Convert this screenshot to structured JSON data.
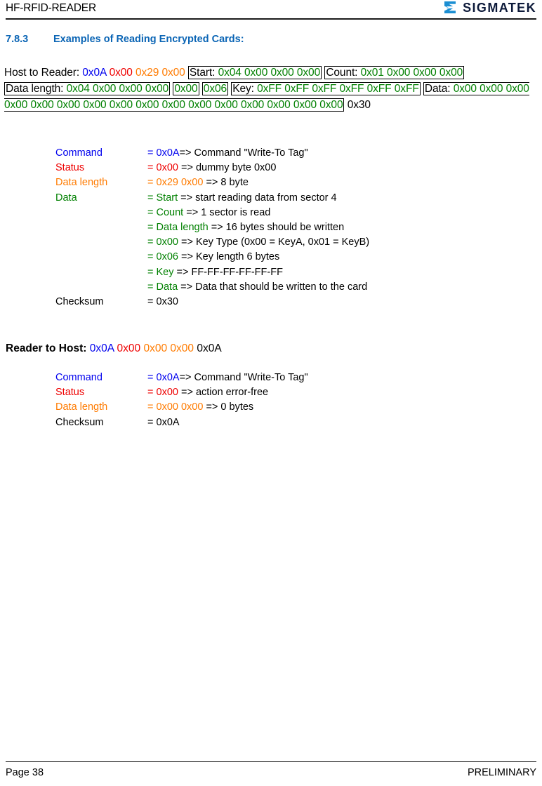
{
  "header": {
    "title": "HF-RFID-READER",
    "brand_name": "SIGMATEK",
    "brand_color": "#1b8ed2",
    "rule_color": "#1a1a1a"
  },
  "section": {
    "number": "7.8.3",
    "title": "Examples of Reading Encrypted Cards:",
    "color": "#0b65b5"
  },
  "colors": {
    "command": "#0000ee",
    "status": "#ee0000",
    "data_length": "#ff7b00",
    "data": "#008000",
    "plain": "#000000"
  },
  "host_to_reader": {
    "label": "Host to Reader:",
    "segments": [
      {
        "text": "Host to Reader:",
        "color": "plain",
        "boxed": false
      },
      {
        "text": "0x0A",
        "color": "command",
        "boxed": false
      },
      {
        "text": "0x00",
        "color": "status",
        "boxed": false
      },
      {
        "text": "0x29",
        "color": "data_length",
        "boxed": false
      },
      {
        "text": "0x00",
        "color": "data_length",
        "boxed": false
      },
      {
        "text": "Start: 0x04 0x00 0x00 0x00",
        "color": "mixed-start",
        "boxed": true
      },
      {
        "text": "Count: 0x01 0x00 0x00 0x00",
        "color": "mixed-count",
        "boxed": true
      },
      {
        "text": "Data length: 0x04 0x00 0x00 0x00",
        "color": "mixed-length",
        "boxed": true
      },
      {
        "text": "0x00",
        "color": "data",
        "boxed": true
      },
      {
        "text": "0x06",
        "color": "data",
        "boxed": true
      },
      {
        "text": "Key: 0xFF 0xFF 0xFF 0xFF 0xFF 0xFF",
        "color": "mixed-key",
        "boxed": true
      },
      {
        "text": "Data: 0x00 ×16",
        "color": "mixed-data",
        "boxed": true
      },
      {
        "text": "0x30",
        "color": "plain",
        "boxed": false
      }
    ],
    "prefix_bytes": {
      "command": "0x0A",
      "status": "0x00",
      "data_length": [
        "0x29",
        "0x00"
      ]
    },
    "start_box": {
      "label": "Start:",
      "bytes": [
        "0x04",
        "0x00",
        "0x00",
        "0x00"
      ]
    },
    "count_box": {
      "label": "Count:",
      "bytes": [
        "0x01",
        "0x00",
        "0x00",
        "0x00"
      ]
    },
    "length_box": {
      "label": "Data length:",
      "bytes": [
        "0x04",
        "0x00",
        "0x00",
        "0x00"
      ]
    },
    "keytype_box": {
      "bytes": [
        "0x00"
      ]
    },
    "keylen_box": {
      "bytes": [
        "0x06"
      ]
    },
    "key_box": {
      "label": "Key:",
      "bytes": [
        "0xFF",
        "0xFF",
        "0xFF",
        "0xFF",
        "0xFF",
        "0xFF"
      ]
    },
    "data_box": {
      "label": "Data:",
      "bytes": [
        "0x00",
        "0x00",
        "0x00",
        "0x00",
        "0x00",
        "0x00",
        "0x00",
        "0x00",
        "0x00",
        "0x00",
        "0x00",
        "0x00",
        "0x00",
        "0x00",
        "0x00",
        "0x00"
      ]
    },
    "checksum": "0x30"
  },
  "host_description": {
    "rows": [
      {
        "label": "Command",
        "label_color": "command",
        "eq": "= ",
        "value": "0x0A",
        "value_color": "command",
        "rest": "=> Command \"Write-To Tag\""
      },
      {
        "label": "Status",
        "label_color": "status",
        "eq": "= ",
        "value": "0x00",
        "value_color": "status",
        "rest": " => dummy byte 0x00"
      },
      {
        "label": "Data length",
        "label_color": "data_length",
        "eq": "=  ",
        "value": "0x29 0x00",
        "value_color": "data_length",
        "rest": " => 8 byte"
      },
      {
        "label": "Data",
        "label_color": "data",
        "eq": "= ",
        "value": "Start",
        "value_color": "data",
        "rest": " => start reading data from sector 4"
      },
      {
        "label": "",
        "label_color": "plain",
        "eq": "= ",
        "value": "Count",
        "value_color": "data",
        "rest": " => 1 sector is read"
      },
      {
        "label": "",
        "label_color": "plain",
        "eq": "= ",
        "value": "Data length",
        "value_color": "data",
        "rest": " => 16 bytes should be written"
      },
      {
        "label": "",
        "label_color": "plain",
        "eq": "= ",
        "value": "0x00",
        "value_color": "data",
        "rest": " => Key Type (0x00 = KeyA, 0x01 = KeyB)"
      },
      {
        "label": "",
        "label_color": "plain",
        "eq": "= ",
        "value": "0x06",
        "value_color": "data",
        "rest": " => Key length 6 bytes"
      },
      {
        "label": "",
        "label_color": "plain",
        "eq": "= ",
        "value": "Key",
        "value_color": "data",
        "rest": " => FF-FF-FF-FF-FF-FF"
      },
      {
        "label": "",
        "label_color": "plain",
        "eq": "= ",
        "value": "Data",
        "value_color": "data",
        "rest": " => Data that should be written to the card"
      },
      {
        "label": "Checksum",
        "label_color": "plain",
        "eq": "= ",
        "value": "0x30",
        "value_color": "plain",
        "rest": ""
      }
    ]
  },
  "reader_to_host": {
    "label": "Reader to Host:",
    "bytes": [
      {
        "text": "0x0A",
        "color": "command"
      },
      {
        "text": "0x00",
        "color": "status"
      },
      {
        "text": "0x00",
        "color": "data_length"
      },
      {
        "text": "0x00",
        "color": "data_length"
      },
      {
        "text": "0x0A",
        "color": "plain"
      }
    ]
  },
  "reader_description": {
    "rows": [
      {
        "label": "Command",
        "label_color": "command",
        "eq": "= ",
        "value": "0x0A",
        "value_color": "command",
        "rest": "=> Command \"Write-To Tag\""
      },
      {
        "label": "Status",
        "label_color": "status",
        "eq": "= ",
        "value": "0x00",
        "value_color": "status",
        "rest": " => action error-free"
      },
      {
        "label": "Data length",
        "label_color": "data_length",
        "eq": "=  ",
        "value": "0x00 0x00",
        "value_color": "data_length",
        "rest": " => 0 bytes"
      },
      {
        "label": "Checksum",
        "label_color": "plain",
        "eq": "= ",
        "value": "0x0A",
        "value_color": "plain",
        "rest": ""
      }
    ]
  },
  "footer": {
    "page": "Page 38",
    "status": "PRELIMINARY"
  }
}
